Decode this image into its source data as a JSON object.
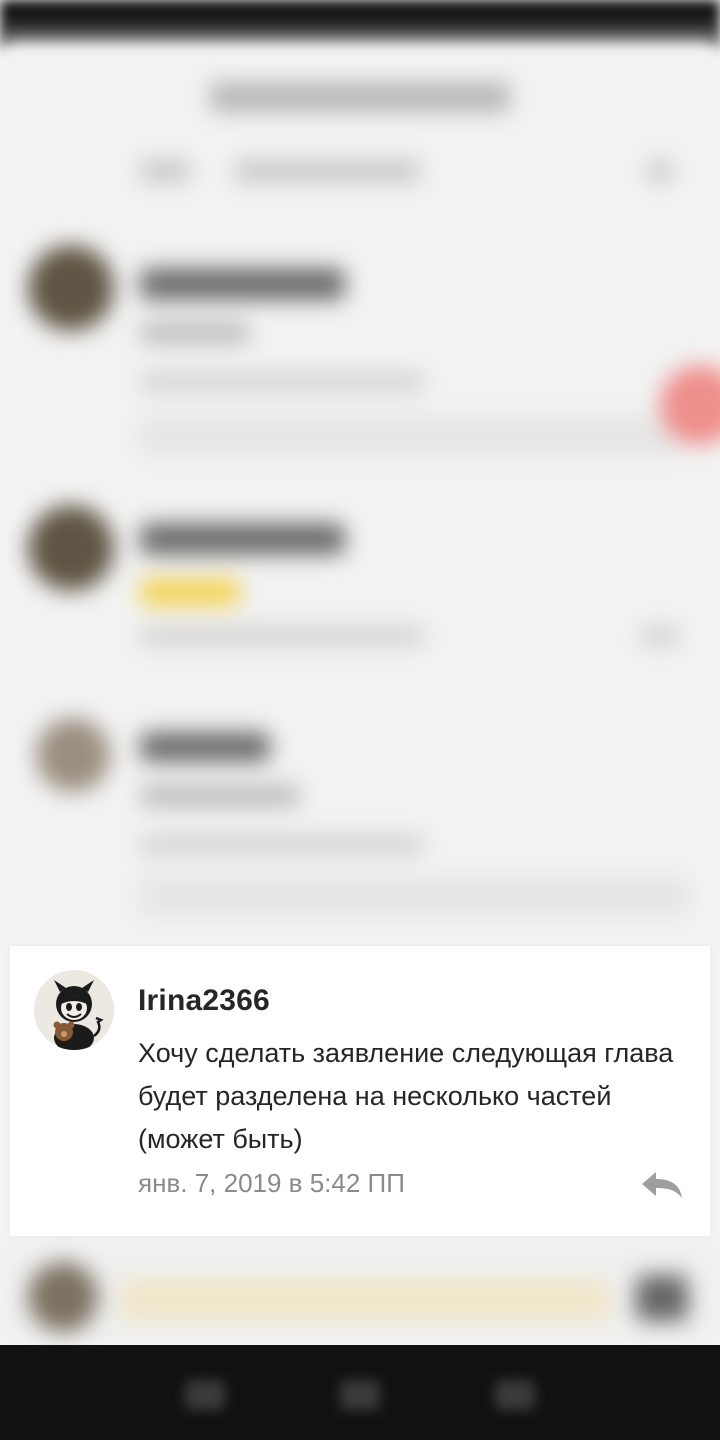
{
  "comment": {
    "author": "Irina2366",
    "text": "Хочу сделать заявление следующая глава будет разделена на несколько частей (может быть)",
    "timestamp": "янв. 7, 2019 в 5:42 ПП"
  },
  "icons": {
    "reply": "reply-icon",
    "avatar": "cartoon-character-avatar"
  },
  "colors": {
    "accent_red": "#ee8f8c",
    "badge_yellow": "#f4d55a",
    "text_primary": "#262626",
    "text_secondary": "#8a8a8a"
  }
}
